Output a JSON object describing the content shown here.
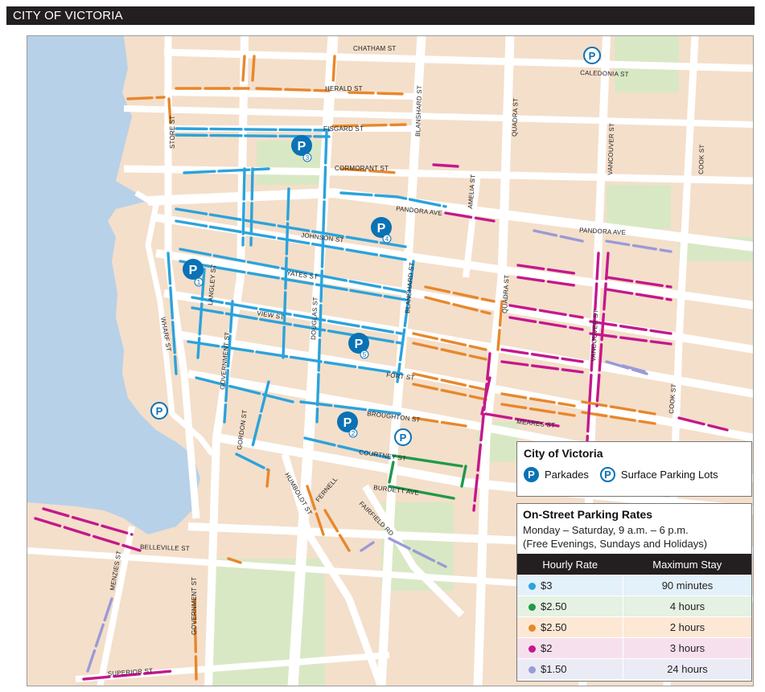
{
  "header": {
    "title": "CITY OF VICTORIA"
  },
  "colors": {
    "water": "#b7d1e9",
    "land": "#f4dfcb",
    "park": "#d9e8c4",
    "road": "#ffffff",
    "parkade": "#0a72b5",
    "rate_blue": "#2ba3db",
    "rate_green": "#1f9a48",
    "rate_orange": "#e8872b",
    "rate_magenta": "#c4188c",
    "rate_lavender": "#9a9ad6"
  },
  "streets": [
    "CHATHAM ST",
    "CALEDONIA ST",
    "HERALD ST",
    "FISGARD ST",
    "CORMORANT ST",
    "PANDORA AVE",
    "PANDORA AVE",
    "JOHNSON ST",
    "YATES ST",
    "VIEW ST",
    "FORT ST",
    "BROUGHTON ST",
    "COURTNEY ST",
    "BURDETT AVE",
    "MEARES ST",
    "BELLEVILLE ST",
    "SUPERIOR ST",
    "STORE ST",
    "WHARF ST",
    "LANGLEY ST",
    "GOVERNMENT ST",
    "GOVERNMENT ST",
    "GORDON ST",
    "DOUGLAS ST",
    "BLANSHARD ST",
    "BLANSHARD ST",
    "AMELIA ST",
    "QUADRA ST",
    "QUADRA ST",
    "VANCOUVER ST",
    "VANCOUVER ST",
    "COOK ST",
    "COOK ST",
    "MENZIES ST",
    "HUMBOLDT ST",
    "FERNELL",
    "FAIRFIELD RD"
  ],
  "parkades": [
    {
      "symbol": "P",
      "number": "1"
    },
    {
      "symbol": "P",
      "number": "2"
    },
    {
      "symbol": "P",
      "number": "3"
    },
    {
      "symbol": "P",
      "number": "4"
    },
    {
      "symbol": "P",
      "number": "5"
    }
  ],
  "surface_lots": [
    {
      "symbol": "P"
    },
    {
      "symbol": "P"
    },
    {
      "symbol": "P"
    }
  ],
  "legend": {
    "title": "City of Victoria",
    "parkades_label": "Parkades",
    "surface_label": "Surface Parking Lots",
    "symbol": "P"
  },
  "rates": {
    "title": "On-Street Parking Rates",
    "hours": "Monday – Saturday, 9 a.m. – 6 p.m.",
    "note": "(Free Evenings, Sundays and Holidays)",
    "col_rate": "Hourly Rate",
    "col_stay": "Maximum Stay",
    "rows": [
      {
        "rate": "$3",
        "stay": "90 minutes",
        "color": "#2ba3db",
        "bg": "#e3f1fa"
      },
      {
        "rate": "$2.50",
        "stay": "4 hours",
        "color": "#1f9a48",
        "bg": "#e5f1e2"
      },
      {
        "rate": "$2.50",
        "stay": "2 hours",
        "color": "#e8872b",
        "bg": "#fde8d6"
      },
      {
        "rate": "$2",
        "stay": "3 hours",
        "color": "#c4188c",
        "bg": "#f7e0ee"
      },
      {
        "rate": "$1.50",
        "stay": "24 hours",
        "color": "#9a9ad6",
        "bg": "#ebebf6"
      }
    ]
  }
}
